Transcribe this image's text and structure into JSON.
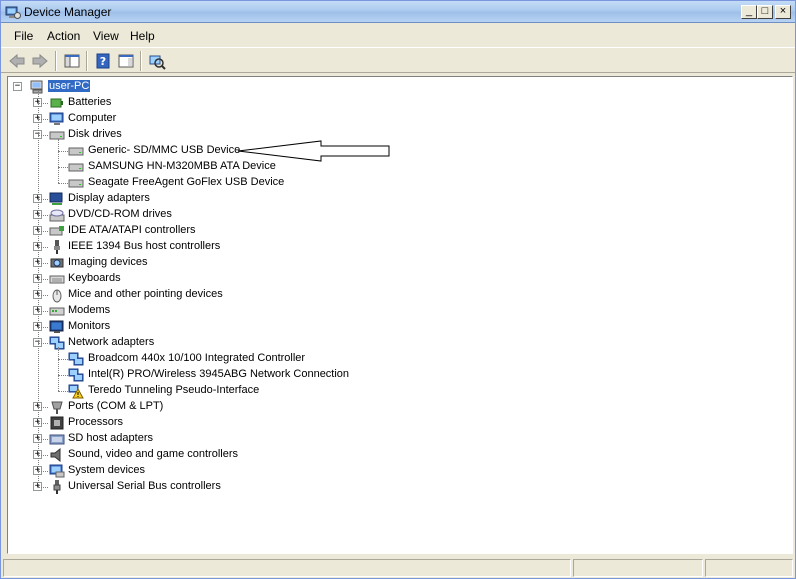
{
  "window": {
    "title": "Device Manager"
  },
  "titlebar": {
    "min": "_",
    "max": "□",
    "close": "×"
  },
  "menu": {
    "file": "File",
    "action": "Action",
    "view": "View",
    "help": "Help"
  },
  "tree": {
    "root": "user-PC",
    "categories": [
      {
        "label": "Batteries",
        "icon": "battery-icon"
      },
      {
        "label": "Computer",
        "icon": "computer-icon"
      },
      {
        "label": "Disk drives",
        "icon": "disk-drive-icon"
      },
      {
        "label": "Display adapters",
        "icon": "display-adapter-icon"
      },
      {
        "label": "DVD/CD-ROM drives",
        "icon": "dvd-icon"
      },
      {
        "label": "IDE ATA/ATAPI controllers",
        "icon": "ide-controller-icon"
      },
      {
        "label": "IEEE 1394 Bus host controllers",
        "icon": "ieee1394-icon"
      },
      {
        "label": "Imaging devices",
        "icon": "camera-icon"
      },
      {
        "label": "Keyboards",
        "icon": "keyboard-icon"
      },
      {
        "label": "Mice and other pointing devices",
        "icon": "mouse-icon"
      },
      {
        "label": "Modems",
        "icon": "modem-icon"
      },
      {
        "label": "Monitors",
        "icon": "monitor-icon"
      },
      {
        "label": "Network adapters",
        "icon": "network-adapter-icon"
      },
      {
        "label": "Ports (COM & LPT)",
        "icon": "port-icon"
      },
      {
        "label": "Processors",
        "icon": "processor-icon"
      },
      {
        "label": "SD host adapters",
        "icon": "sd-adapter-icon"
      },
      {
        "label": "Sound, video and game controllers",
        "icon": "speaker-icon"
      },
      {
        "label": "System devices",
        "icon": "system-device-icon"
      },
      {
        "label": "Universal Serial Bus controllers",
        "icon": "usb-icon"
      }
    ],
    "disk_drives": [
      "Generic- SD/MMC USB Device",
      "SAMSUNG HN-M320MBB ATA Device",
      "Seagate FreeAgent GoFlex USB Device"
    ],
    "network_adapters": [
      "Broadcom 440x 10/100 Integrated Controller",
      "Intel(R) PRO/Wireless 3945ABG Network Connection",
      "Teredo Tunneling Pseudo-Interface"
    ]
  },
  "expander": {
    "plus": "+",
    "minus": "−"
  }
}
